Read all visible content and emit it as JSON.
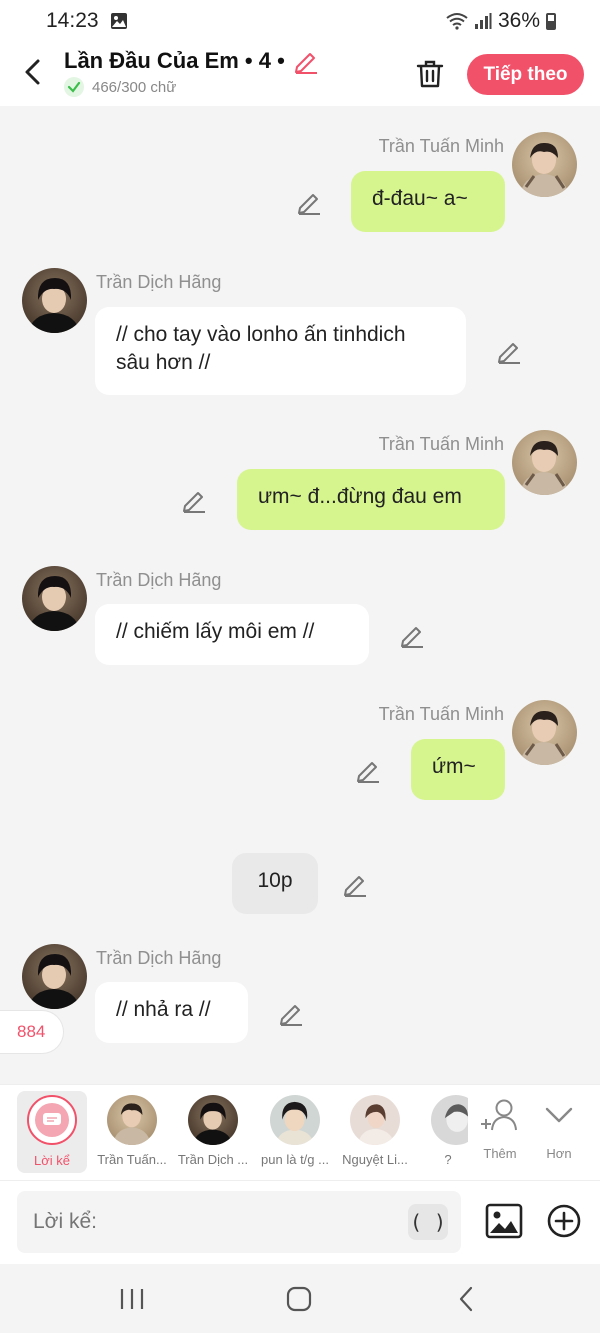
{
  "status_bar": {
    "time": "14:23",
    "battery": "36%"
  },
  "header": {
    "title": "Lần Đầu Của Em • 4 •",
    "word_count": "466/300 chữ",
    "next_label": "Tiếp theo"
  },
  "messages": [
    {
      "sender": "Trần Tuấn Minh",
      "text": "đ-đau~ a~",
      "side": "right"
    },
    {
      "sender": "Trần Dịch Hãng",
      "text": "// cho tay vào lonho ấn tinhdich sâu hơn //",
      "side": "left"
    },
    {
      "sender": "Trần Tuấn Minh",
      "text": "ưm~ đ...đừng đau em",
      "side": "right"
    },
    {
      "sender": "Trần Dịch Hãng",
      "text": "// chiếm lấy môi em //",
      "side": "left"
    },
    {
      "sender": "Trần Tuấn Minh",
      "text": "ứm~",
      "side": "right"
    },
    {
      "sender": "",
      "text": "10p",
      "side": "center"
    },
    {
      "sender": "Trần Dịch Hãng",
      "text": "// nhả ra //",
      "side": "left"
    }
  ],
  "side_count": "884",
  "character_bar": {
    "narrator_label": "Lời kể",
    "characters": [
      {
        "label": "Trần Tuấn..."
      },
      {
        "label": "Trần Dịch ..."
      },
      {
        "label": "pun là t/g ..."
      },
      {
        "label": "Nguyệt Li..."
      },
      {
        "label": "?"
      }
    ],
    "add_label": "Thêm",
    "more_label": "Hơn"
  },
  "input": {
    "placeholder": "Lời kể:",
    "paren_label": "( )"
  },
  "colors": {
    "accent": "#f2516a",
    "bubble_right": "#d6f58f",
    "bubble_left": "#ffffff"
  }
}
